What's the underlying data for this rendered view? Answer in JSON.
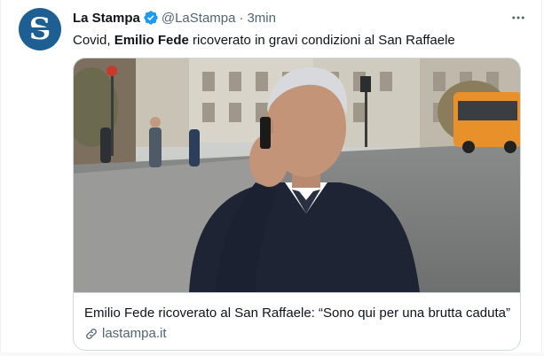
{
  "tweet": {
    "display_name": "La Stampa",
    "handle": "@LaStampa",
    "separator": "·",
    "time": "3min",
    "text_prefix": "Covid, ",
    "text_bold": "Emilio Fede",
    "text_suffix": " ricoverato in gravi condizioni al San Raffaele",
    "more_icon": "more-horizontal-icon",
    "verified_icon": "verified-badge-icon"
  },
  "card": {
    "title": "Emilio Fede ricoverato al San Raffaele: “Sono qui per una brutta caduta”",
    "domain": "lastampa.it",
    "link_icon": "link-icon"
  },
  "colors": {
    "brand_avatar": "#1d5f93",
    "verified": "#1d9bf0",
    "secondary_text": "#536471",
    "border": "#cfd9de"
  }
}
